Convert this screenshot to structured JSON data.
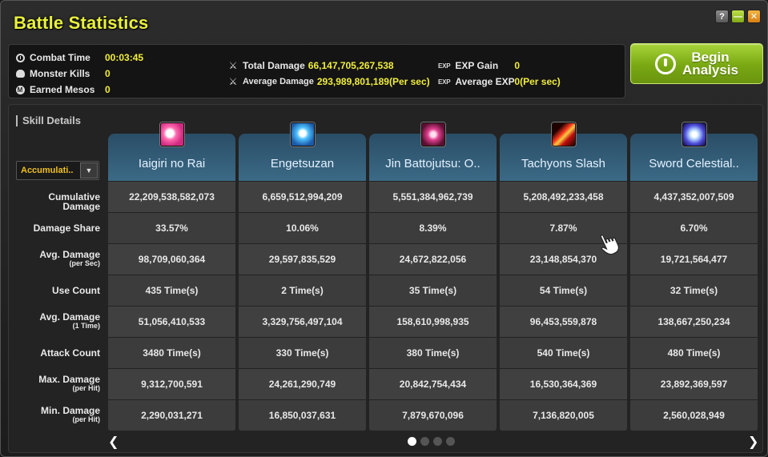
{
  "window": {
    "title": "Battle Statistics"
  },
  "summary": {
    "combat_time_label": "Combat Time",
    "combat_time": "00:03:45",
    "monster_kills_label": "Monster Kills",
    "monster_kills": "0",
    "earned_mesos_label": "Earned Mesos",
    "earned_mesos": "0",
    "total_damage_label": "Total Damage",
    "total_damage": "66,147,705,267,538",
    "average_damage_label": "Average Damage",
    "average_damage": "293,989,801,189(Per sec)",
    "exp_gain_label": "EXP Gain",
    "exp_gain": "0",
    "average_exp_label": "Average EXP",
    "average_exp": "0(Per sec)",
    "exp_icon_text": "EXP"
  },
  "begin_button": {
    "line1": "Begin",
    "line2": "Analysis"
  },
  "details": {
    "label": "Skill Details",
    "dropdown_value": "Accumulati..",
    "row_labels": [
      {
        "main": "Cumulative Damage",
        "sub": ""
      },
      {
        "main": "Damage Share",
        "sub": ""
      },
      {
        "main": "Avg. Damage",
        "sub": "(per Sec)"
      },
      {
        "main": "Use Count",
        "sub": ""
      },
      {
        "main": "Avg. Damage",
        "sub": "(1 Time)"
      },
      {
        "main": "Attack Count",
        "sub": ""
      },
      {
        "main": "Max. Damage",
        "sub": "(per Hit)"
      },
      {
        "main": "Min. Damage",
        "sub": "(per Hit)"
      }
    ],
    "skills": [
      {
        "name": "Iaigiri no Rai",
        "icon": "iaigiri-skill-icon",
        "values": [
          "22,209,538,582,073",
          "33.57%",
          "98,709,060,364",
          "435 Time(s)",
          "51,056,410,533",
          "3480 Time(s)",
          "9,312,700,591",
          "2,290,031,271"
        ]
      },
      {
        "name": "Engetsuzan",
        "icon": "engetsuzan-skill-icon",
        "values": [
          "6,659,512,994,209",
          "10.06%",
          "29,597,835,529",
          "2 Time(s)",
          "3,329,756,497,104",
          "330 Time(s)",
          "24,261,290,749",
          "16,850,037,631"
        ]
      },
      {
        "name": "Jin Battojutsu: O..",
        "icon": "jin-battojutsu-skill-icon",
        "values": [
          "5,551,384,962,739",
          "8.39%",
          "24,672,822,056",
          "35 Time(s)",
          "158,610,998,935",
          "380 Time(s)",
          "20,842,754,434",
          "7,879,670,096"
        ]
      },
      {
        "name": "Tachyons Slash",
        "icon": "tachyons-slash-skill-icon",
        "values": [
          "5,208,492,233,458",
          "7.87%",
          "23,148,854,370",
          "54 Time(s)",
          "96,453,559,878",
          "540 Time(s)",
          "16,530,364,369",
          "7,136,820,005"
        ]
      },
      {
        "name": "Sword Celestial..",
        "icon": "sword-celestial-skill-icon",
        "values": [
          "4,437,352,007,509",
          "6.70%",
          "19,721,564,477",
          "32 Time(s)",
          "138,667,250,234",
          "480 Time(s)",
          "23,892,369,597",
          "2,560,028,949"
        ]
      }
    ]
  },
  "pagination": {
    "pages": 4,
    "current": 1
  }
}
